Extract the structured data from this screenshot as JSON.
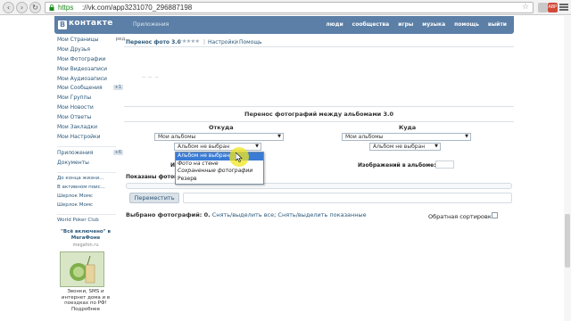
{
  "browser": {
    "url_scheme": "https",
    "url_rest": "://vk.com/app3231070_296887198",
    "ext_badge": "ABP"
  },
  "vk": {
    "logo_letter": "В",
    "brand": "контакте",
    "app_crumb": "Приложения",
    "topnav": [
      "люди",
      "сообщества",
      "игры",
      "музыка",
      "помощь",
      "выйти"
    ]
  },
  "left_menu": {
    "items": [
      {
        "label": "Мои Страницы",
        "extra": "ред."
      },
      {
        "label": "Мои Друзья"
      },
      {
        "label": "Мои Фотографии"
      },
      {
        "label": "Мои Видеозаписи"
      },
      {
        "label": "Мои Аудиозаписи"
      },
      {
        "label": "Мои Сообщения",
        "badge": "+1"
      },
      {
        "label": "Мои Группы"
      },
      {
        "label": "Мои Новости"
      },
      {
        "label": "Мои Ответы"
      },
      {
        "label": "Мои Закладки"
      },
      {
        "label": "Мои Настройки"
      }
    ],
    "items2": [
      {
        "label": "Приложения",
        "badge": "+6"
      },
      {
        "label": "Документы"
      }
    ],
    "links": [
      "До конца жизни...",
      "В активном поис...",
      "Шерлок Момс",
      "Шерлок Момс"
    ],
    "game_link": "World Poker Club"
  },
  "ad": {
    "title": "\"Всё включено\" в МегаФоне",
    "domain": "megafon.ru",
    "text": "Звонки, SMS и интернет дома и в поездках по РФ! Подробнее"
  },
  "app": {
    "title": "Перенос фото 3.0",
    "stars": "★★★★★",
    "settings_link": "Настройки",
    "help_link": "Помощь",
    "tiny_text": "— — —",
    "panel_title": "Перенос фотографий между альбомами 3.0",
    "from_head": "Откуда",
    "to_head": "Куда",
    "from_albums_select": "Мои альбомы",
    "from_album_select": "Альбом не выбран",
    "to_albums_select": "Мои альбомы",
    "to_album_select": "Альбом не выбран",
    "dropdown_options": [
      "Альбом не выбран",
      "Фото на стене",
      "Сохраненные фотографии",
      "Резерв"
    ],
    "images_label_left": "И",
    "images_label_right": "Изображений в альбоме:",
    "shown_label": "Показаны фотогр",
    "move_button": "Переместить",
    "selected_prefix": "Выбрано фотографий: 0.",
    "select_all": "Снять/выделить все",
    "select_shown": "Снять/выделить показанные",
    "reverse_sort": "Обратная сортировка"
  }
}
